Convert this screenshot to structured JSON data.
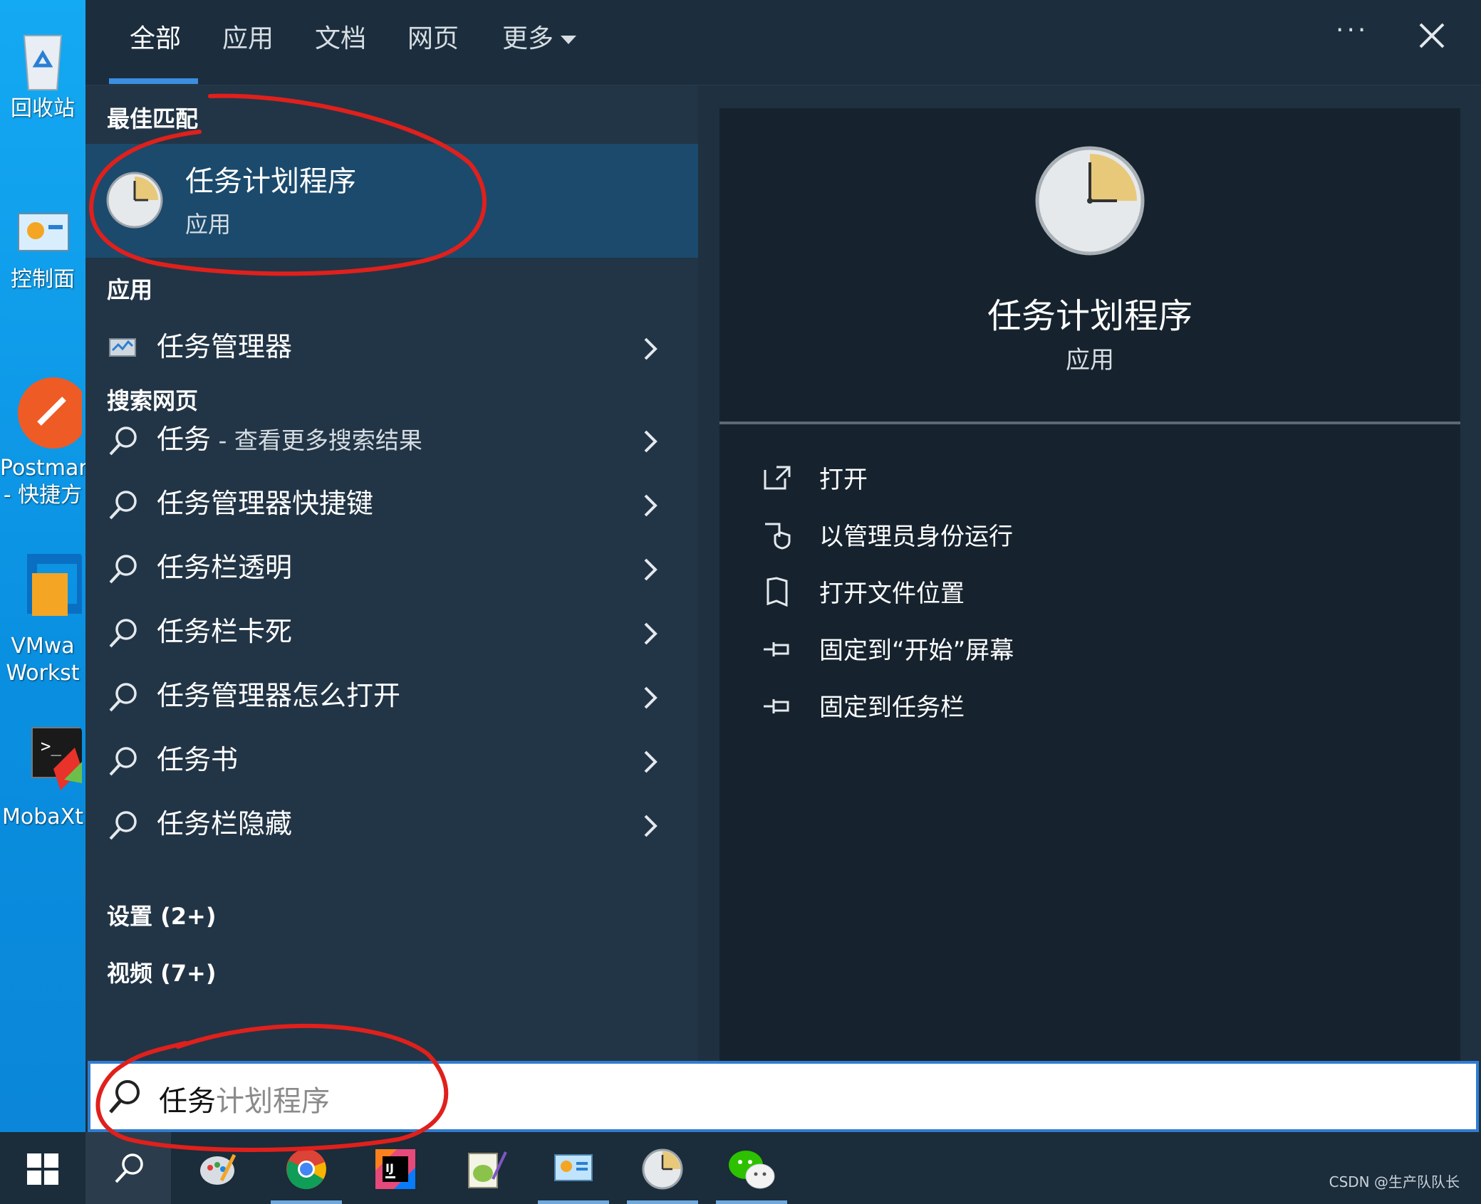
{
  "desktop": {
    "icons": [
      {
        "label": "回收站",
        "icon": "recycle-bin-icon"
      },
      {
        "label": "控制面",
        "icon": "control-panel-icon"
      },
      {
        "label": "Postman",
        "label2": "- 快捷方",
        "icon": "postman-icon"
      },
      {
        "label": "VMwa",
        "label2": "Workst",
        "icon": "vmware-icon"
      },
      {
        "label": "MobaXt",
        "icon": "mobaxterm-icon"
      }
    ]
  },
  "tabs": [
    {
      "label": "全部"
    },
    {
      "label": "应用"
    },
    {
      "label": "文档"
    },
    {
      "label": "网页"
    },
    {
      "label": "更多"
    }
  ],
  "topbar": {
    "more_dots": "···"
  },
  "left": {
    "best_match_header": "最佳匹配",
    "best_match": {
      "title": "任务计划程序",
      "subtitle": "应用",
      "icon": "task-scheduler-clock-icon"
    },
    "apps_header": "应用",
    "apps": [
      {
        "label": "任务管理器",
        "icon": "task-manager-icon"
      }
    ],
    "web_header": "搜索网页",
    "web": [
      {
        "label": "任务",
        "hint": " - 查看更多搜索结果"
      },
      {
        "label": "任务管理器快捷键",
        "hint": ""
      },
      {
        "label": "任务栏透明",
        "hint": ""
      },
      {
        "label": "任务栏卡死",
        "hint": ""
      },
      {
        "label": "任务管理器怎么打开",
        "hint": ""
      },
      {
        "label": "任务书",
        "hint": ""
      },
      {
        "label": "任务栏隐藏",
        "hint": ""
      }
    ],
    "settings_header": "设置 (2+)",
    "videos_header": "视频 (7+)"
  },
  "right": {
    "title": "任务计划程序",
    "subtitle": "应用",
    "actions": [
      {
        "label": "打开",
        "icon": "open-icon"
      },
      {
        "label": "以管理员身份运行",
        "icon": "shield-icon"
      },
      {
        "label": "打开文件位置",
        "icon": "file-location-icon"
      },
      {
        "label": "固定到“开始”屏幕",
        "icon": "pin-icon"
      },
      {
        "label": "固定到任务栏",
        "icon": "pin-icon"
      }
    ]
  },
  "search": {
    "typed": "任务",
    "suggestion": "计划程序"
  },
  "taskbar": {
    "items": [
      {
        "icon": "windows-start-icon"
      },
      {
        "icon": "search-icon"
      },
      {
        "icon": "paint-icon"
      },
      {
        "icon": "chrome-icon"
      },
      {
        "icon": "intellij-icon"
      },
      {
        "icon": "notepad-plus-icon"
      },
      {
        "icon": "control-panel-icon"
      },
      {
        "icon": "task-scheduler-clock-icon"
      },
      {
        "icon": "wechat-icon"
      }
    ]
  },
  "watermark": "CSDN @生产队队长",
  "colors": {
    "accent": "#3b8ee0",
    "annotation": "#e0201c",
    "selected": "#1b4a6c"
  }
}
